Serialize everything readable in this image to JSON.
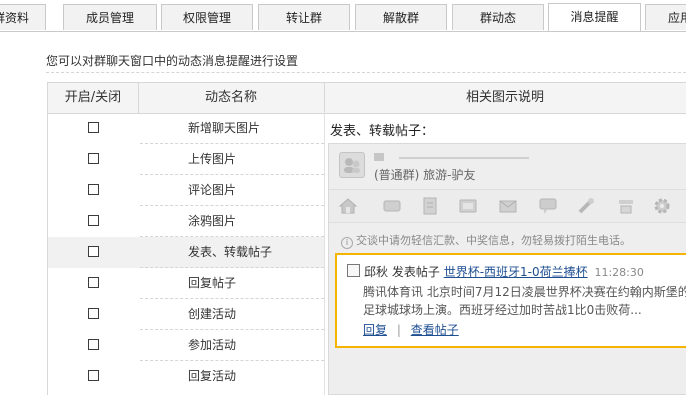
{
  "tabs": [
    {
      "label": "群资料",
      "active": false
    },
    {
      "label": "成员管理",
      "active": false
    },
    {
      "label": "权限管理",
      "active": false
    },
    {
      "label": "转让群",
      "active": false
    },
    {
      "label": "解散群",
      "active": false
    },
    {
      "label": "群动态",
      "active": false
    },
    {
      "label": "消息提醒",
      "active": true
    },
    {
      "label": "应用",
      "active": false
    }
  ],
  "intro": "您可以对群聊天窗口中的动态消息提醒进行设置",
  "table": {
    "headers": {
      "toggle": "开启/关闭",
      "name": "动态名称",
      "desc": "相关图示说明"
    },
    "rows": [
      {
        "name": "新增聊天图片",
        "checked": false
      },
      {
        "name": "上传图片",
        "checked": false
      },
      {
        "name": "评论图片",
        "checked": false
      },
      {
        "name": "涂鸦图片",
        "checked": false
      },
      {
        "name": "发表、转载帖子",
        "checked": false
      },
      {
        "name": "回复帖子",
        "checked": false
      },
      {
        "name": "创建活动",
        "checked": false
      },
      {
        "name": "参加活动",
        "checked": false
      },
      {
        "name": "回复活动",
        "checked": false
      }
    ]
  },
  "description": {
    "title": "发表、转载帖子：",
    "preview": {
      "group_name": "(普通群) 旅游-驴友",
      "warning": "交谈中请勿轻信汇款、中奖信息，勿轻易拨打陌生电话。",
      "message": {
        "user": "邱秋",
        "action": "发表帖子",
        "post_title": "世界杯-西班牙1-0荷兰捧杯",
        "time": "11:28:30",
        "body": "腾讯体育讯 北京时间7月12日凌晨世界杯决赛在约翰内斯堡的足球城球场上演。西班牙经过加时苦战1比0击败荷...",
        "reply_link": "回复",
        "separator": "|",
        "view_link": "查看帖子"
      }
    }
  },
  "colors": {
    "accent_border": "#f4b400",
    "link": "#1d4f91"
  }
}
